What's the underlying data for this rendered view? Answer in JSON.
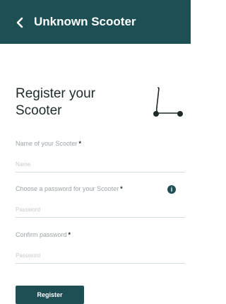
{
  "header": {
    "title": "Unknown Scooter",
    "back_icon": "chevron-left-icon",
    "background": "#1d4f54"
  },
  "form": {
    "heading": "Register your Scooter",
    "illustration_icon": "scooter-icon",
    "fields": [
      {
        "label": "Name of your Scooter",
        "required_mark": "*",
        "placeholder": "Name",
        "value": ""
      },
      {
        "label": "Choose a password for your Scooter",
        "required_mark": "*",
        "placeholder": "Password",
        "value": "",
        "info_icon": "info-icon"
      },
      {
        "label": "Confirm password",
        "required_mark": "*",
        "placeholder": "Password",
        "value": ""
      }
    ],
    "submit_label": "Register"
  },
  "colors": {
    "accent": "#1d4f54",
    "text": "#1e2a2b",
    "muted": "#9aa5a7",
    "line": "#d6dbdc"
  }
}
